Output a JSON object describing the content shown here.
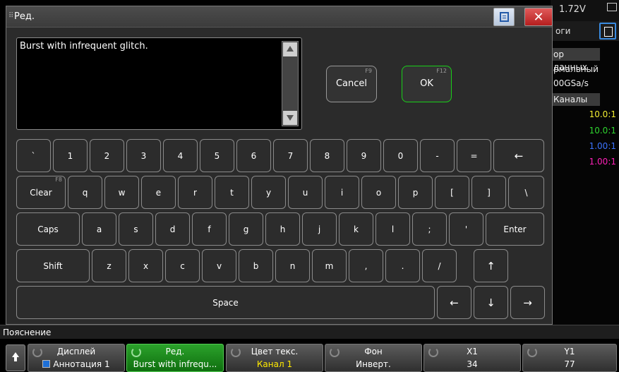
{
  "background": {
    "voltage": "1.72V",
    "tab_label": "оги",
    "section1": "ор данных",
    "line1": "рмальный",
    "line2": "00GSa/s",
    "section2": "Каналы",
    "ratios": [
      {
        "value": "10.0:1",
        "color": "#f2ee32"
      },
      {
        "value": "10.0:1",
        "color": "#2fd52f"
      },
      {
        "value": "1.00:1",
        "color": "#3b74ff"
      },
      {
        "value": "1.00:1",
        "color": "#ff20b8"
      }
    ]
  },
  "dialog": {
    "title": "Ред.",
    "text_value": "Burst with infrequent glitch.",
    "cancel_label": "Cancel",
    "cancel_key": "F9",
    "ok_label": "OK",
    "ok_key": "F12",
    "accent_color": "#19d019"
  },
  "keyboard": {
    "row1": [
      "`",
      "1",
      "2",
      "3",
      "4",
      "5",
      "6",
      "7",
      "8",
      "9",
      "0",
      "-",
      "=",
      "←"
    ],
    "row2": [
      "Clear",
      "q",
      "w",
      "e",
      "r",
      "t",
      "y",
      "u",
      "i",
      "o",
      "p",
      "[",
      "]",
      "\\"
    ],
    "clear_key": "F8",
    "row3": [
      "Caps",
      "a",
      "s",
      "d",
      "f",
      "g",
      "h",
      "j",
      "k",
      "l",
      ";",
      "'",
      "Enter"
    ],
    "row4": [
      "Shift",
      "z",
      "x",
      "c",
      "v",
      "b",
      "n",
      "m",
      ",",
      ".",
      "/",
      "↑"
    ],
    "row5": [
      "Space",
      "←",
      "↓",
      "→"
    ]
  },
  "softkeys": {
    "menu_label": "Пояснение",
    "keys": [
      {
        "line1": "Дисплей",
        "line2": "Аннотация 1"
      },
      {
        "line1": "Ред.",
        "line2": "Burst with infrequ..."
      },
      {
        "line1": "Цвет текс.",
        "line2": "Канал 1"
      },
      {
        "line1": "Фон",
        "line2": "Инверт."
      },
      {
        "line1": "X1",
        "line2": "34"
      },
      {
        "line1": "Y1",
        "line2": "77"
      }
    ]
  }
}
